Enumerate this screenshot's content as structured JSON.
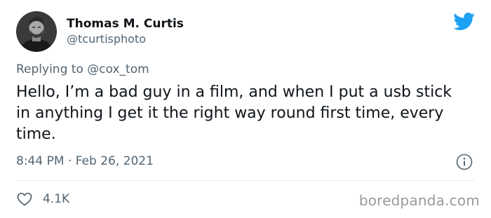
{
  "author": {
    "display_name": "Thomas M. Curtis",
    "handle": "@tcurtisphoto",
    "avatar_icon": "person-photo"
  },
  "brand": {
    "icon": "twitter-bird-icon",
    "color": "#1da1f2"
  },
  "reply": {
    "text": "Replying to @cox_tom"
  },
  "tweet": {
    "text": "Hello, I’m a bad guy in a film, and when I put a usb stick in anything I get it the right way round first time, every time.",
    "timestamp": "8:44 PM · Feb 26, 2021"
  },
  "actions": {
    "like_icon": "heart-outline-icon",
    "like_count": "4.1K",
    "info_icon": "info-icon"
  },
  "watermark": {
    "text": "boredpanda.com"
  },
  "colors": {
    "text_primary": "#0f1419",
    "text_secondary": "#536471",
    "divider": "#e6ecf0"
  }
}
